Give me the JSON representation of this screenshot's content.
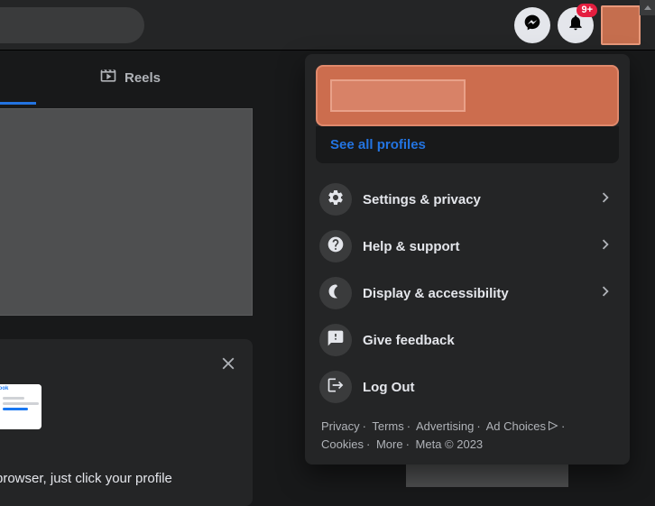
{
  "topbar": {
    "notification_badge": "9+"
  },
  "tabs": {
    "reels": "Reels"
  },
  "card": {
    "text": "is browser, just click your profile"
  },
  "menu": {
    "see_all": "See all profiles",
    "items": [
      {
        "label": "Settings & privacy",
        "has_chevron": true
      },
      {
        "label": "Help & support",
        "has_chevron": true
      },
      {
        "label": "Display & accessibility",
        "has_chevron": true
      },
      {
        "label": "Give feedback",
        "has_chevron": false
      },
      {
        "label": "Log Out",
        "has_chevron": false
      }
    ]
  },
  "footer": {
    "privacy": "Privacy",
    "terms": "Terms",
    "advertising": "Advertising",
    "ad_choices": "Ad Choices",
    "cookies": "Cookies",
    "more": "More",
    "meta": "Meta © 2023"
  }
}
